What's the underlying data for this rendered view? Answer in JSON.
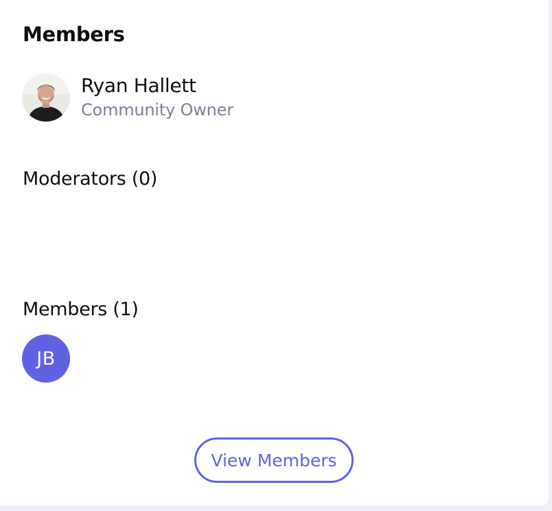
{
  "card": {
    "title": "Members"
  },
  "owner": {
    "name": "Ryan Hallett",
    "role": "Community Owner",
    "avatar_icon": "user-photo"
  },
  "moderators": {
    "heading": "Moderators (0)"
  },
  "members": {
    "heading": "Members (1)",
    "list": [
      {
        "initials": "JB",
        "color": "#5f63e3"
      }
    ]
  },
  "actions": {
    "view_members_label": "View Members"
  },
  "colors": {
    "accent": "#5f63e3",
    "text": "#0d0d12",
    "muted": "#7c8192"
  }
}
